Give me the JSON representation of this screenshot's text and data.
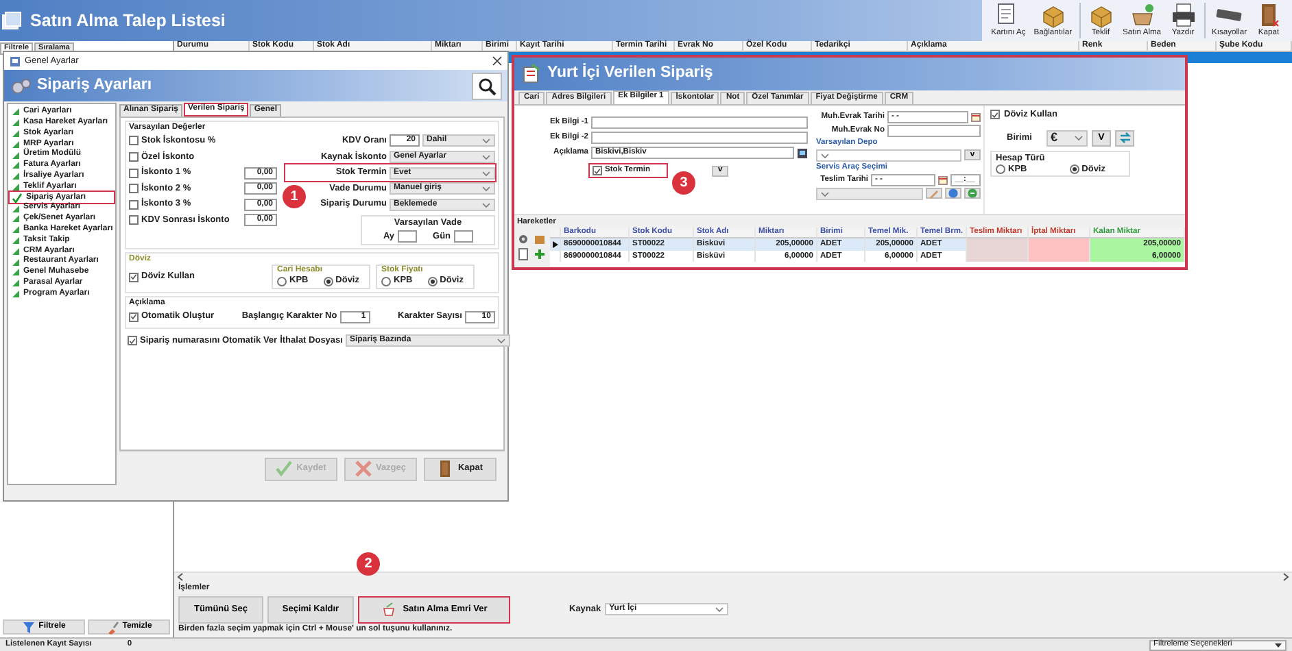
{
  "app": {
    "title": "Satın Alma Talep Listesi",
    "toolbar_groups": [
      [
        {
          "label": "Kartını Aç"
        },
        {
          "label": "Bağlantılar"
        }
      ],
      [
        {
          "label": "Teklif"
        },
        {
          "label": "Satın Alma"
        },
        {
          "label": "Yazdır"
        }
      ],
      [
        {
          "label": "Kısayollar"
        },
        {
          "label": "Kapat"
        }
      ]
    ]
  },
  "side_tabs": [
    {
      "label": "Filtrele",
      "selected": true
    },
    {
      "label": "Sıralama",
      "selected": false
    }
  ],
  "side_buttons": [
    "Filtrele",
    "Temizle"
  ],
  "grid": {
    "columns": [
      "Durumu",
      "Stok Kodu",
      "Stok Adı",
      "Miktarı",
      "Birimi",
      "Kayıt Tarihi",
      "Termin Tarihi",
      "Evrak No",
      "Özel Kodu",
      "Tedarikçi",
      "Açıklama",
      "Renk",
      "Beden",
      "Şube Kodu"
    ],
    "rows": [
      {
        "selected": true
      }
    ]
  },
  "actions": {
    "title": "İşlemler",
    "buttons": [
      {
        "label": "Tümünü Seç",
        "highlighted": false
      },
      {
        "label": "Seçimi Kaldır",
        "highlighted": false
      },
      {
        "label": "Satın Alma Emri Ver",
        "highlighted": true,
        "callout": "2"
      }
    ],
    "source_label": "Kaynak",
    "source_value": "Yurt İçi",
    "hint": "Birden fazla seçim yapmak için Ctrl + Mouse' un sol tuşunu kullanınız."
  },
  "status_bar": {
    "label": "Listelenen Kayıt Sayısı",
    "value": "0",
    "filter_options": "Filtreleme Seçenekleri"
  },
  "settings_dialog": {
    "window_title": "Genel Ayarlar",
    "header": "Sipariş Ayarları",
    "categories": [
      {
        "label": "Cari Ayarları",
        "selected": false,
        "highlighted": false
      },
      {
        "label": "Kasa Hareket Ayarları",
        "selected": false,
        "highlighted": false
      },
      {
        "label": "Stok Ayarları",
        "selected": false,
        "highlighted": false
      },
      {
        "label": "MRP Ayarları",
        "selected": false,
        "highlighted": false
      },
      {
        "label": "Üretim Modülü",
        "selected": false,
        "highlighted": false
      },
      {
        "label": "Fatura Ayarları",
        "selected": false,
        "highlighted": false
      },
      {
        "label": "İrsaliye Ayarları",
        "selected": false,
        "highlighted": false
      },
      {
        "label": "Teklif Ayarları",
        "selected": false,
        "highlighted": false
      },
      {
        "label": "Sipariş Ayarları",
        "selected": true,
        "highlighted": true
      },
      {
        "label": "Servis Ayarları",
        "selected": false,
        "highlighted": false
      },
      {
        "label": "Çek/Senet Ayarları",
        "selected": false,
        "highlighted": false
      },
      {
        "label": "Banka Hareket Ayarları",
        "selected": false,
        "highlighted": false
      },
      {
        "label": "Taksit Takip",
        "selected": false,
        "highlighted": false
      },
      {
        "label": "CRM Ayarları",
        "selected": false,
        "highlighted": false
      },
      {
        "label": "Restaurant Ayarları",
        "selected": false,
        "highlighted": false
      },
      {
        "label": "Genel Muhasebe",
        "selected": false,
        "highlighted": false
      },
      {
        "label": "Parasal Ayarlar",
        "selected": false,
        "highlighted": false
      },
      {
        "label": "Program Ayarları",
        "selected": false,
        "highlighted": false
      }
    ],
    "tabs": [
      {
        "label": "Alınan Sipariş",
        "selected": false,
        "highlighted": false
      },
      {
        "label": "Verilen Sipariş",
        "selected": true,
        "highlighted": true
      },
      {
        "label": "Genel",
        "selected": false,
        "highlighted": false
      }
    ],
    "defaults": {
      "title": "Varsayılan Değerler",
      "discounts": [
        {
          "label": "Stok İskontosu %",
          "checked": false
        },
        {
          "label": "Özel İskonto",
          "checked": false
        },
        {
          "label": "İskonto 1 %",
          "checked": false,
          "value": "0,00"
        },
        {
          "label": "İskonto 2 %",
          "checked": false,
          "value": "0,00"
        },
        {
          "label": "İskonto 3 %",
          "checked": false,
          "value": "0,00"
        },
        {
          "label": "KDV Sonrası İskonto",
          "checked": false,
          "value": "0,00"
        }
      ],
      "fields": [
        {
          "label": "KDV Oranı",
          "number": "20",
          "value": "Dahil",
          "highlighted": false
        },
        {
          "label": "Kaynak İskonto",
          "value": "Genel Ayarlar",
          "highlighted": false
        },
        {
          "label": "Stok Termin",
          "value": "Evet",
          "highlighted": true,
          "callout": "1"
        },
        {
          "label": "Vade Durumu",
          "value": "Manuel giriş",
          "highlighted": false
        },
        {
          "label": "Sipariş Durumu",
          "value": "Beklemede",
          "highlighted": false
        }
      ],
      "default_term": {
        "title": "Varsayılan Vade",
        "fields": [
          "Ay",
          "Gün"
        ]
      }
    },
    "currency": {
      "title": "Döviz",
      "use": {
        "label": "Döviz Kullan",
        "checked": true
      },
      "groups": [
        {
          "title": "Cari Hesabı",
          "options": [
            {
              "label": "KPB",
              "selected": false
            },
            {
              "label": "Döviz",
              "selected": true
            }
          ]
        },
        {
          "title": "Stok Fiyatı",
          "options": [
            {
              "label": "KPB",
              "selected": false
            },
            {
              "label": "Döviz",
              "selected": true
            }
          ]
        }
      ]
    },
    "description": {
      "title": "Açıklama",
      "auto": {
        "label": "Otomatik Oluştur",
        "checked": true
      },
      "start_label": "Başlangıç Karakter No",
      "start_value": "1",
      "count_label": "Karakter Sayısı",
      "count_value": "10"
    },
    "auto_number": {
      "label": "Sipariş numarasını Otomatik Ver",
      "checked": true
    },
    "import_file": {
      "label": "İthalat Dosyası",
      "value": "Sipariş Bazında"
    },
    "buttons": [
      {
        "label": "Kaydet",
        "disabled": true
      },
      {
        "label": "Vazgeç",
        "disabled": true
      },
      {
        "label": "Kapat",
        "disabled": false
      }
    ]
  },
  "order_dialog": {
    "title": "Yurt İçi Verilen Sipariş",
    "highlighted": true,
    "tabs": [
      {
        "label": "Cari",
        "selected": false
      },
      {
        "label": "Adres Bilgileri",
        "selected": false
      },
      {
        "label": "Ek Bilgiler 1",
        "selected": true
      },
      {
        "label": "İskontolar",
        "selected": false
      },
      {
        "label": "Not",
        "selected": false
      },
      {
        "label": "Özel Tanımlar",
        "selected": false
      },
      {
        "label": "Fiyat Değiştirme",
        "selected": false
      },
      {
        "label": "CRM",
        "selected": false
      }
    ],
    "extra_fields": [
      {
        "label": "Ek Bilgi -1"
      },
      {
        "label": "Ek Bilgi -2"
      },
      {
        "label": "Açıklama",
        "value": "Biskivi,Biskiv"
      }
    ],
    "stock_term": {
      "label": "Stok Termin",
      "checked": true,
      "highlighted": true,
      "callout": "3"
    },
    "stock_term_button": "v",
    "doc_date": {
      "label": "Muh.Evrak Tarihi",
      "value": "- -"
    },
    "doc_no": {
      "label": "Muh.Evrak No"
    },
    "warehouse": {
      "title": "Varsayılan Depo",
      "button": "v"
    },
    "service": {
      "title": "Servis Araç Seçimi",
      "date_label": "Teslim Tarihi",
      "date_value": "- -",
      "time_value": "__:__"
    },
    "currency": {
      "use": {
        "label": "Döviz Kullan",
        "checked": true
      },
      "unit_label": "Birimi",
      "unit_value": "€",
      "unit_button": "V",
      "account_type": {
        "title": "Hesap Türü",
        "options": [
          {
            "label": "KPB",
            "selected": false
          },
          {
            "label": "Döviz",
            "selected": true
          }
        ]
      }
    },
    "lines": {
      "title": "Hareketler",
      "columns": [
        {
          "label": "Barkodu",
          "kind": "plain"
        },
        {
          "label": "Stok Kodu",
          "kind": "plain"
        },
        {
          "label": "Stok Adı",
          "kind": "plain"
        },
        {
          "label": "Miktarı",
          "kind": "plain"
        },
        {
          "label": "Birimi",
          "kind": "plain"
        },
        {
          "label": "Temel Mik.",
          "kind": "plain"
        },
        {
          "label": "Temel Brm.",
          "kind": "plain"
        },
        {
          "label": "Teslim Miktarı",
          "kind": "delivered"
        },
        {
          "label": "İptal Miktarı",
          "kind": "cancelled"
        },
        {
          "label": "Kalan Miktar",
          "kind": "remaining"
        }
      ],
      "rows": [
        {
          "selected": true,
          "cells": [
            "8690000010844",
            "ST00022",
            "Bisküvi",
            "205,00000",
            "ADET",
            "205,00000",
            "ADET",
            null,
            null,
            "205,00000"
          ]
        },
        {
          "selected": false,
          "cells": [
            "8690000010844",
            "ST00022",
            "Bisküvi",
            "6,00000",
            "ADET",
            "6,00000",
            "ADET",
            null,
            null,
            "6,00000"
          ]
        }
      ]
    }
  }
}
